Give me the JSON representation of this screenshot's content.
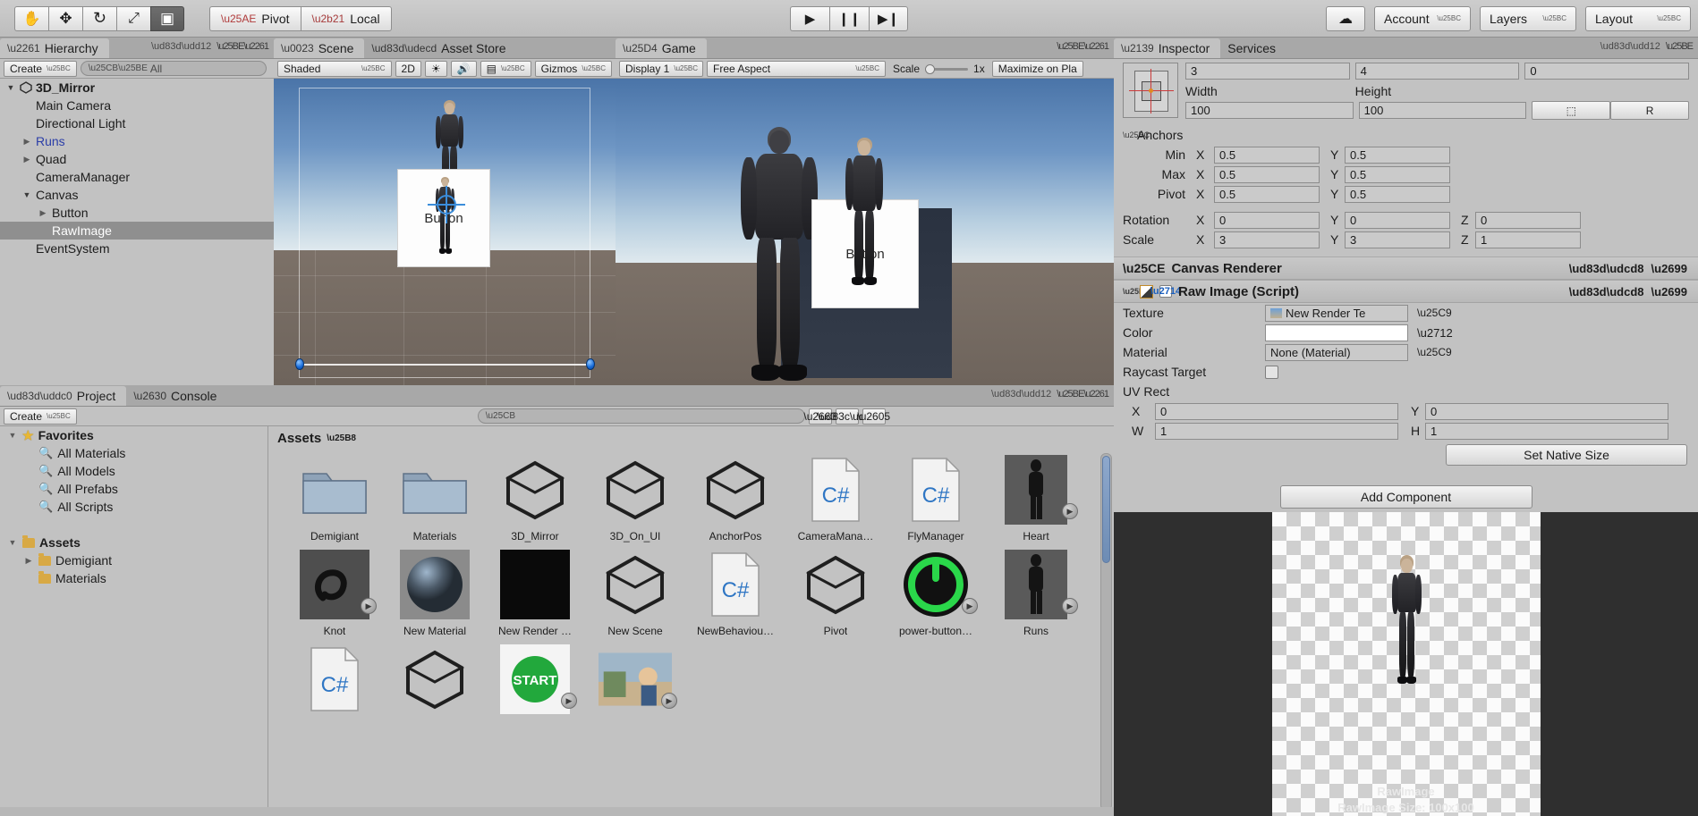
{
  "toolbar": {
    "tools": [
      {
        "name": "hand-tool",
        "glyph": "✋"
      },
      {
        "name": "move-tool",
        "glyph": "✥"
      },
      {
        "name": "rotate-tool",
        "glyph": "↻"
      },
      {
        "name": "scale-tool",
        "glyph": "⤢"
      },
      {
        "name": "rect-tool",
        "glyph": "▣"
      }
    ],
    "pivot_label": "Pivot",
    "local_label": "Local",
    "play_label": "▶",
    "pause_label": "❙❙",
    "step_label": "▶❙",
    "cloud_label": "☁",
    "account_label": "Account",
    "layers_label": "Layers",
    "layout_label": "Layout"
  },
  "hierarchy": {
    "tab_label": "Hierarchy",
    "create_label": "Create",
    "search_placeholder": "All",
    "items": [
      {
        "label": "3D_Mirror",
        "depth": 0,
        "foldout": "open",
        "root": true,
        "selected": false,
        "blue": false
      },
      {
        "label": "Main Camera",
        "depth": 1,
        "foldout": "none",
        "root": false,
        "selected": false,
        "blue": false
      },
      {
        "label": "Directional Light",
        "depth": 1,
        "foldout": "none",
        "root": false,
        "selected": false,
        "blue": false
      },
      {
        "label": "Runs",
        "depth": 1,
        "foldout": "closed",
        "root": false,
        "selected": false,
        "blue": true
      },
      {
        "label": "Quad",
        "depth": 1,
        "foldout": "closed",
        "root": false,
        "selected": false,
        "blue": false
      },
      {
        "label": "CameraManager",
        "depth": 1,
        "foldout": "none",
        "root": false,
        "selected": false,
        "blue": false
      },
      {
        "label": "Canvas",
        "depth": 1,
        "foldout": "open",
        "root": false,
        "selected": false,
        "blue": false
      },
      {
        "label": "Button",
        "depth": 2,
        "foldout": "closed",
        "root": false,
        "selected": false,
        "blue": false
      },
      {
        "label": "RawImage",
        "depth": 2,
        "foldout": "none",
        "root": false,
        "selected": true,
        "blue": true
      },
      {
        "label": "EventSystem",
        "depth": 1,
        "foldout": "none",
        "root": false,
        "selected": false,
        "blue": false
      }
    ]
  },
  "scene": {
    "tab_label": "Scene",
    "assetstore_tab_label": "Asset Store",
    "shading_label": "Shaded",
    "mode_2d_label": "2D",
    "light_label": "☀",
    "audio_label": "🔊",
    "fx_label": "▤",
    "gizmos_label": "Gizmos",
    "button_card_label": "Button"
  },
  "game": {
    "tab_label": "Game",
    "display_label": "Display 1",
    "aspect_label": "Free Aspect",
    "scale_label": "Scale",
    "scale_value": "1x",
    "maximize_label": "Maximize on Pla",
    "button_card_label": "Button"
  },
  "project": {
    "tab_label": "Project",
    "console_tab_label": "Console",
    "create_label": "Create",
    "search_placeholder": "",
    "breadcrumb": "Assets",
    "tree": [
      {
        "label": "Favorites",
        "depth": 0,
        "icon": "star",
        "foldout": "open",
        "bold": true
      },
      {
        "label": "All Materials",
        "depth": 1,
        "icon": "magn",
        "foldout": "none",
        "bold": false
      },
      {
        "label": "All Models",
        "depth": 1,
        "icon": "magn",
        "foldout": "none",
        "bold": false
      },
      {
        "label": "All Prefabs",
        "depth": 1,
        "icon": "magn",
        "foldout": "none",
        "bold": false
      },
      {
        "label": "All Scripts",
        "depth": 1,
        "icon": "magn",
        "foldout": "none",
        "bold": false
      },
      {
        "label": "",
        "depth": 0,
        "icon": "none",
        "foldout": "none",
        "bold": false
      },
      {
        "label": "Assets",
        "depth": 0,
        "icon": "folder",
        "foldout": "open",
        "bold": true
      },
      {
        "label": "Demigiant",
        "depth": 1,
        "icon": "folder",
        "foldout": "closed",
        "bold": false
      },
      {
        "label": "Materials",
        "depth": 1,
        "icon": "folder",
        "foldout": "none",
        "bold": false
      }
    ],
    "assets": [
      {
        "label": "Demigiant",
        "kind": "folder",
        "badge": false
      },
      {
        "label": "Materials",
        "kind": "folder",
        "badge": false
      },
      {
        "label": "3D_Mirror",
        "kind": "scene",
        "badge": false
      },
      {
        "label": "3D_On_UI",
        "kind": "scene",
        "badge": false
      },
      {
        "label": "AnchorPos",
        "kind": "scene",
        "badge": false
      },
      {
        "label": "CameraMana…",
        "kind": "script",
        "badge": false
      },
      {
        "label": "FlyManager",
        "kind": "script",
        "badge": false
      },
      {
        "label": "Heart",
        "kind": "model",
        "badge": true
      },
      {
        "label": "Knot",
        "kind": "knot",
        "badge": true
      },
      {
        "label": "New Material",
        "kind": "material",
        "badge": false
      },
      {
        "label": "New Render …",
        "kind": "rendertex",
        "badge": false
      },
      {
        "label": "New Scene",
        "kind": "scene",
        "badge": false
      },
      {
        "label": "NewBehaviou…",
        "kind": "script",
        "badge": false
      },
      {
        "label": "Pivot",
        "kind": "scene",
        "badge": false
      },
      {
        "label": "power-button…",
        "kind": "power",
        "badge": true
      },
      {
        "label": "Runs",
        "kind": "model",
        "badge": true
      },
      {
        "label": "",
        "kind": "script",
        "badge": false
      },
      {
        "label": "",
        "kind": "scene",
        "badge": false
      },
      {
        "label": "",
        "kind": "start",
        "badge": true
      },
      {
        "label": "",
        "kind": "photo",
        "badge": true
      }
    ]
  },
  "inspector": {
    "tab_label": "Inspector",
    "services_tab_label": "Services",
    "rect": {
      "pos_x": "3",
      "pos_y": "4",
      "pos_z": "0",
      "width_label": "Width",
      "height_label": "Height",
      "width": "100",
      "height": "100",
      "blueprint_label": "⬚",
      "raw_label": "R"
    },
    "anchors": {
      "title": "Anchors",
      "min_label": "Min",
      "min_x": "0.5",
      "min_y": "0.5",
      "max_label": "Max",
      "max_x": "0.5",
      "max_y": "0.5",
      "pivot_label": "Pivot",
      "pivot_x": "0.5",
      "pivot_y": "0.5"
    },
    "transform": {
      "rotation_label": "Rotation",
      "rot_x": "0",
      "rot_y": "0",
      "rot_z": "0",
      "scale_label": "Scale",
      "scale_x": "3",
      "scale_y": "3",
      "scale_z": "1"
    },
    "canvas_renderer": {
      "title": "Canvas Renderer"
    },
    "raw_image": {
      "title": "Raw Image (Script)",
      "enabled": true,
      "texture_label": "Texture",
      "texture_value": "New Render Te",
      "color_label": "Color",
      "color_value": "#ffffff",
      "material_label": "Material",
      "material_value": "None (Material)",
      "raycast_label": "Raycast Target",
      "raycast_checked": false,
      "uv_label": "UV Rect",
      "uv_x_label": "X",
      "uv_x": "0",
      "uv_y_label": "Y",
      "uv_y": "0",
      "uv_w_label": "W",
      "uv_w": "1",
      "uv_h_label": "H",
      "uv_h": "1",
      "set_native_label": "Set Native Size"
    },
    "add_component_label": "Add Component",
    "preview": {
      "header": "RawImage",
      "title": "RawImage",
      "subtitle": "RawImage Size: 100x100"
    },
    "axis_x": "X",
    "axis_y": "Y",
    "axis_z": "Z"
  }
}
